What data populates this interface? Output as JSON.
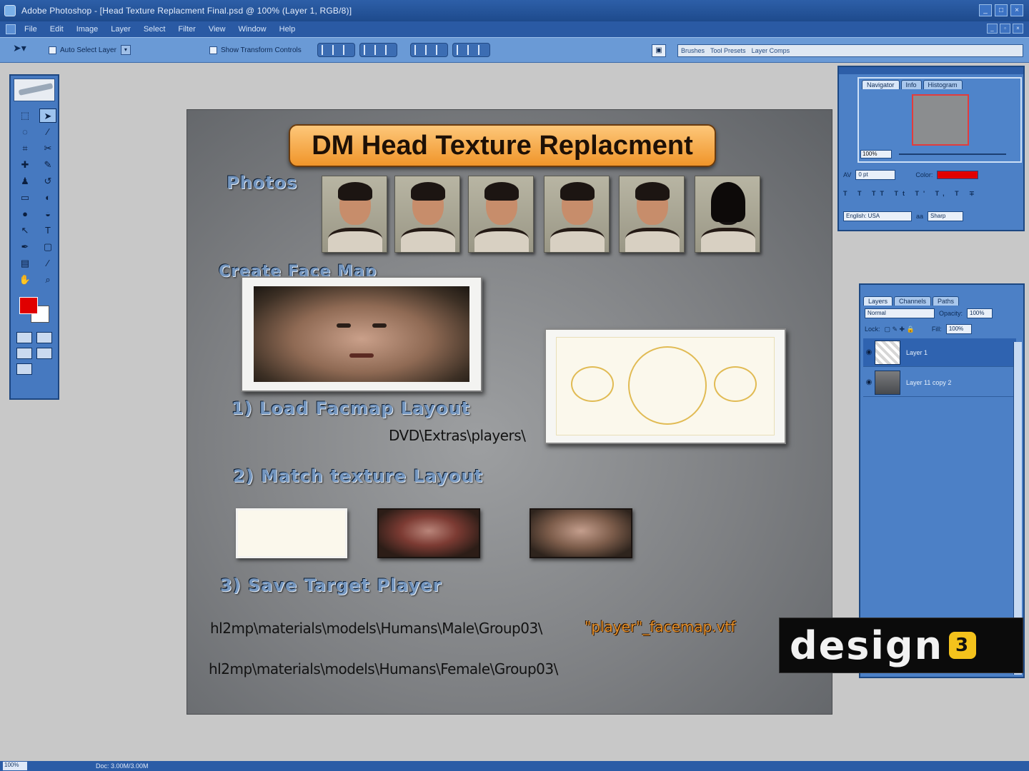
{
  "window": {
    "title": "Adobe Photoshop - [Head Texture Replacment Final.psd @ 100% (Layer 1, RGB/8)]"
  },
  "menu": [
    "File",
    "Edit",
    "Image",
    "Layer",
    "Select",
    "Filter",
    "View",
    "Window",
    "Help"
  ],
  "options": {
    "auto_select": "Auto Select Layer",
    "show_transform": "Show Transform Controls",
    "palette_well_tabs": [
      "Brushes",
      "Tool Presets",
      "Layer Comps"
    ]
  },
  "canvas": {
    "banner": "DM Head Texture Replacment",
    "photos_label": "Photos",
    "create_face_map": "Create Face Map",
    "step1": "1) Load Facmap Layout",
    "step1_path": "DVD\\Extras\\players\\",
    "step2": "2) Match texture Layout",
    "step3": "3) Save Target Player",
    "male_path": "hl2mp\\materials\\models\\Humans\\Male\\Group03\\",
    "player_file": "\"player\"_facemap.vtf",
    "female_path": "hl2mp\\materials\\models\\Humans\\Female\\Group03\\"
  },
  "navigator": {
    "tabs": [
      "Navigator",
      "Info",
      "Histogram"
    ],
    "zoom": "100%",
    "tracking": "0 pt",
    "color_label": "Color:",
    "language": "English: USA",
    "antialias": "Sharp"
  },
  "layers": {
    "tabs": [
      "Layers",
      "Channels",
      "Paths"
    ],
    "blend_mode": "Normal",
    "opacity_label": "Opacity:",
    "opacity": "100%",
    "lock_label": "Lock:",
    "fill_label": "Fill:",
    "fill": "100%",
    "items": [
      {
        "name": "Layer 1"
      },
      {
        "name": "Layer 11 copy 2"
      }
    ]
  },
  "watermark": {
    "text": "design",
    "badge": "3"
  },
  "status": {
    "zoom": "100%",
    "doc": "Doc: 3.00M/3.00M"
  }
}
